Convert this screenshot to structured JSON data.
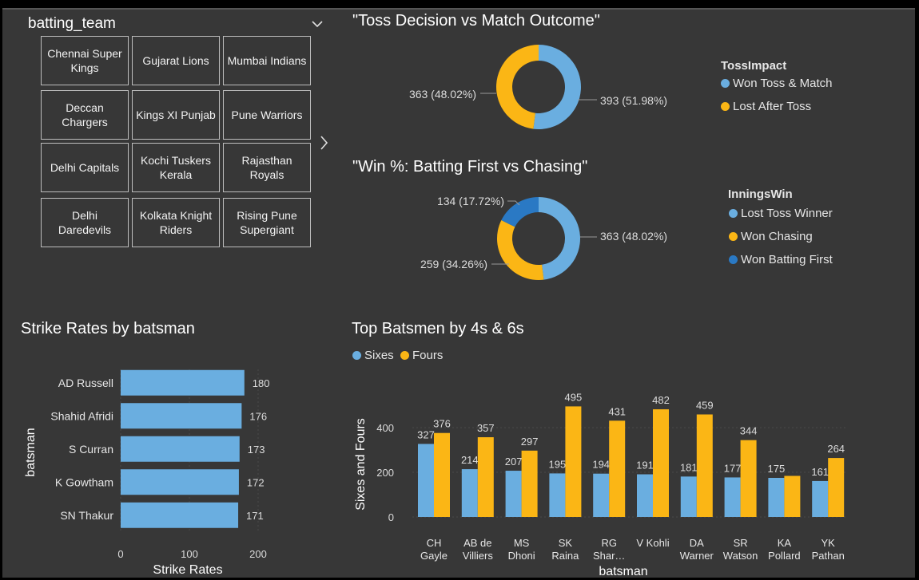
{
  "slicer": {
    "title": "batting_team",
    "teams": [
      [
        "Chennai Super Kings",
        "Gujarat Lions",
        "Mumbai Indians"
      ],
      [
        "Deccan Chargers",
        "Kings XI Punjab",
        "Pune Warriors"
      ],
      [
        "Delhi Capitals",
        "Kochi Tuskers Kerala",
        "Rajasthan Royals"
      ],
      [
        "Delhi Daredevils",
        "Kolkata Knight Riders",
        "Rising Pune Supergiant"
      ]
    ]
  },
  "colors": {
    "light_blue": "#6aaee0",
    "gold": "#fbb615",
    "dark_blue": "#2a79c4",
    "background": "#373737"
  },
  "chart_data": [
    {
      "type": "donut",
      "title": "\"Toss Decision vs Match Outcome\"",
      "legend_title": "TossImpact",
      "slices": [
        {
          "name": "Won Toss & Match",
          "value": 393,
          "label": "393 (51.98%)",
          "color": "#6aaee0"
        },
        {
          "name": "Lost After Toss",
          "value": 363,
          "label": "363 (48.02%)",
          "color": "#fbb615"
        }
      ]
    },
    {
      "type": "donut",
      "title": "\"Win %: Batting First vs Chasing\"",
      "legend_title": "InningsWin",
      "slices": [
        {
          "name": "Lost Toss Winner",
          "value": 363,
          "label": "363 (48.02%)",
          "color": "#6aaee0"
        },
        {
          "name": "Won Chasing",
          "value": 259,
          "label": "259 (34.26%)",
          "color": "#fbb615"
        },
        {
          "name": "Won Batting First",
          "value": 134,
          "label": "134 (17.72%)",
          "color": "#2a79c4"
        }
      ]
    },
    {
      "type": "bar",
      "orientation": "horizontal",
      "title": "Strike Rates by batsman",
      "xlabel": "Strike Rates",
      "ylabel": "batsman",
      "categories": [
        "AD Russell",
        "Shahid Afridi",
        "S Curran",
        "K Gowtham",
        "SN Thakur"
      ],
      "values": [
        180,
        176,
        173,
        172,
        171
      ],
      "xlim": [
        0,
        200
      ],
      "xticks": [
        0,
        100,
        200
      ],
      "color": "#6aaee0"
    },
    {
      "type": "bar",
      "orientation": "vertical",
      "title": "Top Batsmen by 4s & 6s",
      "xlabel": "batsman",
      "ylabel": "Sixes and Fours",
      "categories": [
        [
          "CH",
          "Gayle"
        ],
        [
          "AB de",
          "Villiers"
        ],
        [
          "MS",
          "Dhoni"
        ],
        [
          "SK",
          "Raina"
        ],
        [
          "RG",
          "Shar…"
        ],
        [
          "V Kohli",
          ""
        ],
        [
          "DA",
          "Warner"
        ],
        [
          "SR",
          "Watson"
        ],
        [
          "KA",
          "Pollard"
        ],
        [
          "YK",
          "Pathan"
        ]
      ],
      "series": [
        {
          "name": "Sixes",
          "values": [
            327,
            214,
            207,
            195,
            194,
            191,
            181,
            177,
            175,
            161
          ],
          "color": "#6aaee0"
        },
        {
          "name": "Fours",
          "values": [
            376,
            357,
            297,
            495,
            431,
            482,
            459,
            344,
            184,
            264
          ],
          "color": "#fbb615"
        }
      ],
      "value_labels": {
        "Sixes": [
          "327",
          "214",
          "207",
          "195",
          "194",
          "191",
          "181",
          "177",
          "175",
          "161"
        ],
        "Fours": [
          "376",
          "357",
          "297",
          "495",
          "431",
          "482",
          "459",
          "344",
          "",
          "264"
        ]
      },
      "ylim": [
        0,
        500
      ],
      "yticks": [
        0,
        200,
        400
      ]
    }
  ]
}
